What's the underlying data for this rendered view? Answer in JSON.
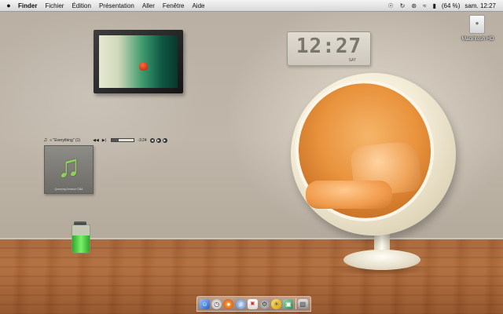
{
  "menubar": {
    "apple_icon": "apple-logo-icon",
    "items": [
      {
        "label": "Finder",
        "bold": true
      },
      {
        "label": "Fichier"
      },
      {
        "label": "Édition"
      },
      {
        "label": "Présentation"
      },
      {
        "label": "Aller"
      },
      {
        "label": "Fenêtre"
      },
      {
        "label": "Aide"
      }
    ],
    "battery_text": "(64 %)",
    "clock_text": "sam. 12:27"
  },
  "desktop": {
    "hd_label": "Macintosh HD"
  },
  "clock_widget": {
    "time": "12:27",
    "day": "SAT"
  },
  "itunes": {
    "track": "« \"Everything\" (1)",
    "remaining": "-3:24",
    "progress": 0.3,
    "album_caption": "Querying Amazon DBA"
  },
  "battery_widget": {
    "level": 0.64,
    "color": "#3fd43a"
  },
  "dock": {
    "icons": [
      "finder-icon",
      "clock-icon",
      "firefox-icon",
      "itunes-icon",
      "ical-icon",
      "system-preferences-icon",
      "iphoto-icon",
      "preview-icon",
      "trash-icon"
    ]
  }
}
